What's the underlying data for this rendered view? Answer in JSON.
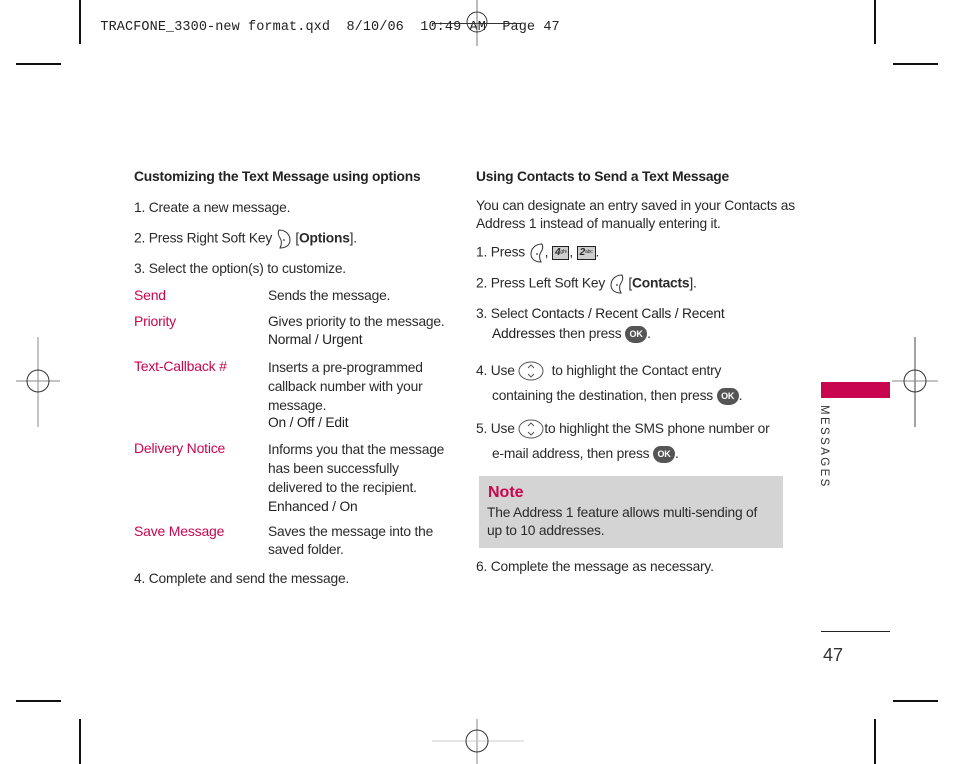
{
  "slug": {
    "filename": "TRACFONE_3300-new format.qxd",
    "date": "8/10/06",
    "time": "10:49 AM",
    "page_label": "Page 47"
  },
  "left": {
    "heading": "Customizing the Text Message using options",
    "step1": "1. Create a new message.",
    "step2_prefix": "2. Press Right Soft Key",
    "step2_key": "Options",
    "step2_open": "[",
    "step2_close": "].",
    "step3": "3. Select the option(s) to customize.",
    "options": [
      {
        "term": "Send",
        "desc": [
          "Sends the message."
        ],
        "values": ""
      },
      {
        "term": "Priority",
        "desc": [
          "Gives priority to the message."
        ],
        "values": "Normal / Urgent"
      },
      {
        "term": "Text-Callback #",
        "desc": [
          "Inserts a pre-programmed",
          "callback number with your",
          "message."
        ],
        "values": "On / Off / Edit"
      },
      {
        "term": "Delivery Notice",
        "desc": [
          "Informs you that the message",
          "has been successfully",
          "delivered to the recipient."
        ],
        "values": "Enhanced / On"
      },
      {
        "term": "Save Message",
        "desc": [
          "Saves the message into the",
          "saved folder."
        ],
        "values": ""
      }
    ],
    "step4": "4. Complete and send the message."
  },
  "right": {
    "heading": "Using Contacts to Send a Text Message",
    "intro_line1": "You can designate an entry saved in your Contacts as",
    "intro_line2": "Address 1 instead of manually entering it.",
    "step1_prefix": "1. Press",
    "step1_sep": ",",
    "step1_end": ".",
    "key4_num": "4",
    "key4_letters": "ghi",
    "key2_num": "2",
    "key2_letters": "abc",
    "step2_prefix": "2. Press Left Soft Key",
    "step2_open": "[",
    "step2_key": "Contacts",
    "step2_close": "].",
    "step3_prefix": "3. Select",
    "step3_bold1": "Contacts / Recent Calls / Recent",
    "step3_bold2": "Addresses",
    "step3_suffix": "then press",
    "step4_prefix": "4. Use",
    "step4_line1": "to highlight the Contact entry",
    "step4_line2": "containing the destination, then press",
    "step5_prefix": "5. Use",
    "step5_line1": "to highlight the SMS phone number or",
    "step5_line2": "e-mail address, then press",
    "period": ".",
    "ok_label": "OK",
    "note": {
      "title": "Note",
      "line1": "The Address 1 feature allows multi-sending of",
      "line2": "up to 10 addresses."
    },
    "step6": "6. Complete the message as necessary."
  },
  "side_tab": {
    "label": "MESSAGES",
    "color": "#c8064f"
  },
  "page_number": "47",
  "accent_color": "#c8064f",
  "note_bg_color": "#d4d4d5"
}
